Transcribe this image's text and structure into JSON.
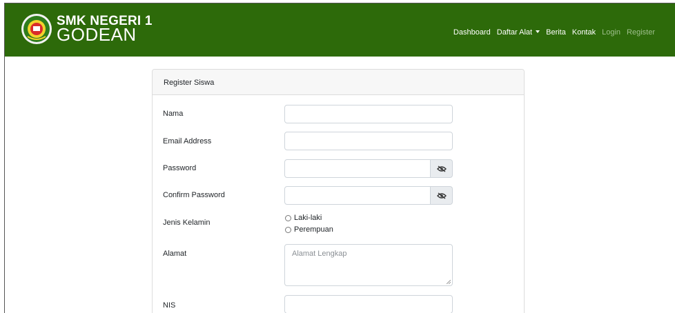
{
  "navbar": {
    "brand_line1": "SMK NEGERI 1",
    "brand_line2": "GODEAN",
    "items": [
      {
        "label": "Dashboard"
      },
      {
        "label": "Daftar Alat"
      },
      {
        "label": "Berita"
      },
      {
        "label": "Kontak"
      },
      {
        "label": "Login"
      },
      {
        "label": "Register"
      }
    ]
  },
  "form": {
    "title": "Register Siswa",
    "fields": {
      "nama": {
        "label": "Nama",
        "value": ""
      },
      "email": {
        "label": "Email Address",
        "value": ""
      },
      "password": {
        "label": "Password",
        "value": ""
      },
      "confirm_password": {
        "label": "Confirm Password",
        "value": ""
      },
      "gender": {
        "label": "Jenis Kelamin",
        "options": [
          "Laki-laki",
          "Perempuan"
        ]
      },
      "alamat": {
        "label": "Alamat",
        "placeholder": "Alamat Lengkap"
      },
      "nis": {
        "label": "NIS",
        "value": ""
      }
    }
  },
  "colors": {
    "navbar_bg": "#2d6a0a",
    "card_header_bg": "#f7f7f7"
  },
  "icons": {
    "logo": "school-logo",
    "toggle_password": "eye-slash-icon",
    "nav_caret": "caret-down-icon"
  }
}
